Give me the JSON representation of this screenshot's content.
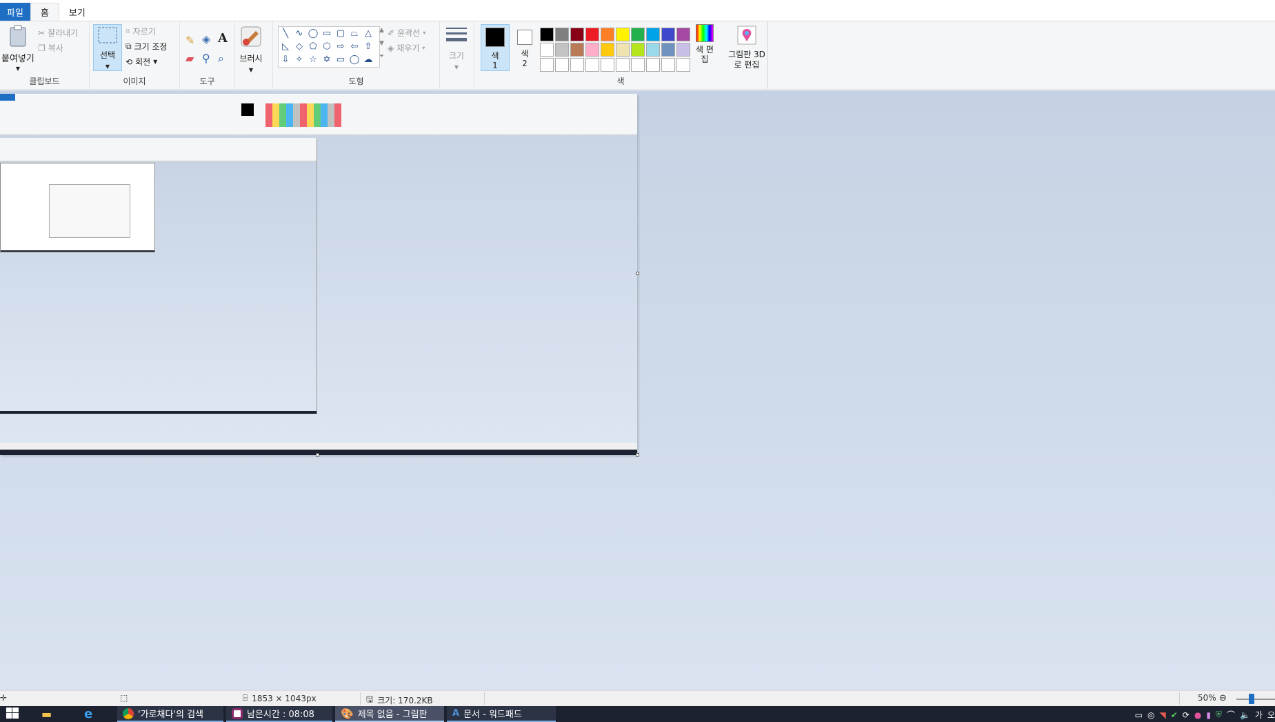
{
  "menu": {
    "file": "파일",
    "home": "홈",
    "view": "보기"
  },
  "ribbon": {
    "clipboard": {
      "paste": "붙여넣기",
      "cut": "잘라내기",
      "copy": "복사",
      "label": "클립보드"
    },
    "image": {
      "select": "선택",
      "crop": "자르기",
      "resize": "크기 조정",
      "rotate": "회전",
      "label": "이미지"
    },
    "tools": {
      "label": "도구"
    },
    "brush": {
      "label": "브러시"
    },
    "shapes": {
      "outline": "윤곽선",
      "fill": "채우기",
      "label": "도형"
    },
    "size": {
      "label": "크기"
    },
    "colors": {
      "color1": "색 1",
      "color2": "색 2",
      "edit": "색 편집",
      "label": "색",
      "color1_value": "#000000",
      "color2_value": "#ffffff",
      "palette_row1": [
        "#000000",
        "#7f7f7f",
        "#880015",
        "#ed1c24",
        "#ff7f27",
        "#fff200",
        "#22b14c",
        "#00a2e8",
        "#3f48cc",
        "#a349a4"
      ],
      "palette_row2": [
        "#ffffff",
        "#c3c3c3",
        "#b97a57",
        "#ffaec9",
        "#ffc90e",
        "#efe4b0",
        "#b5e61d",
        "#99d9ea",
        "#7092be",
        "#c8bfe7"
      ],
      "palette_row3": [
        "#ffffff",
        "#ffffff",
        "#ffffff",
        "#ffffff",
        "#ffffff",
        "#ffffff",
        "#ffffff",
        "#ffffff",
        "#ffffff",
        "#ffffff"
      ]
    },
    "paint3d": {
      "label": "그림판 3D로 편집"
    }
  },
  "status": {
    "dimensions": "1853 × 1043px",
    "size": "크기: 170.2KB",
    "zoom": "50%"
  },
  "taskbar": {
    "items": [
      {
        "label": "'가로채다'의 검색",
        "icon": "chrome-icon"
      },
      {
        "label": "남은시간 : 08:08",
        "icon": "timer-app-icon"
      },
      {
        "label": "제목 없음 - 그림판",
        "icon": "paint-icon"
      },
      {
        "label": "문서 - 워드패드",
        "icon": "wordpad-icon"
      }
    ],
    "tray_lang": "가",
    "clock": "오"
  }
}
